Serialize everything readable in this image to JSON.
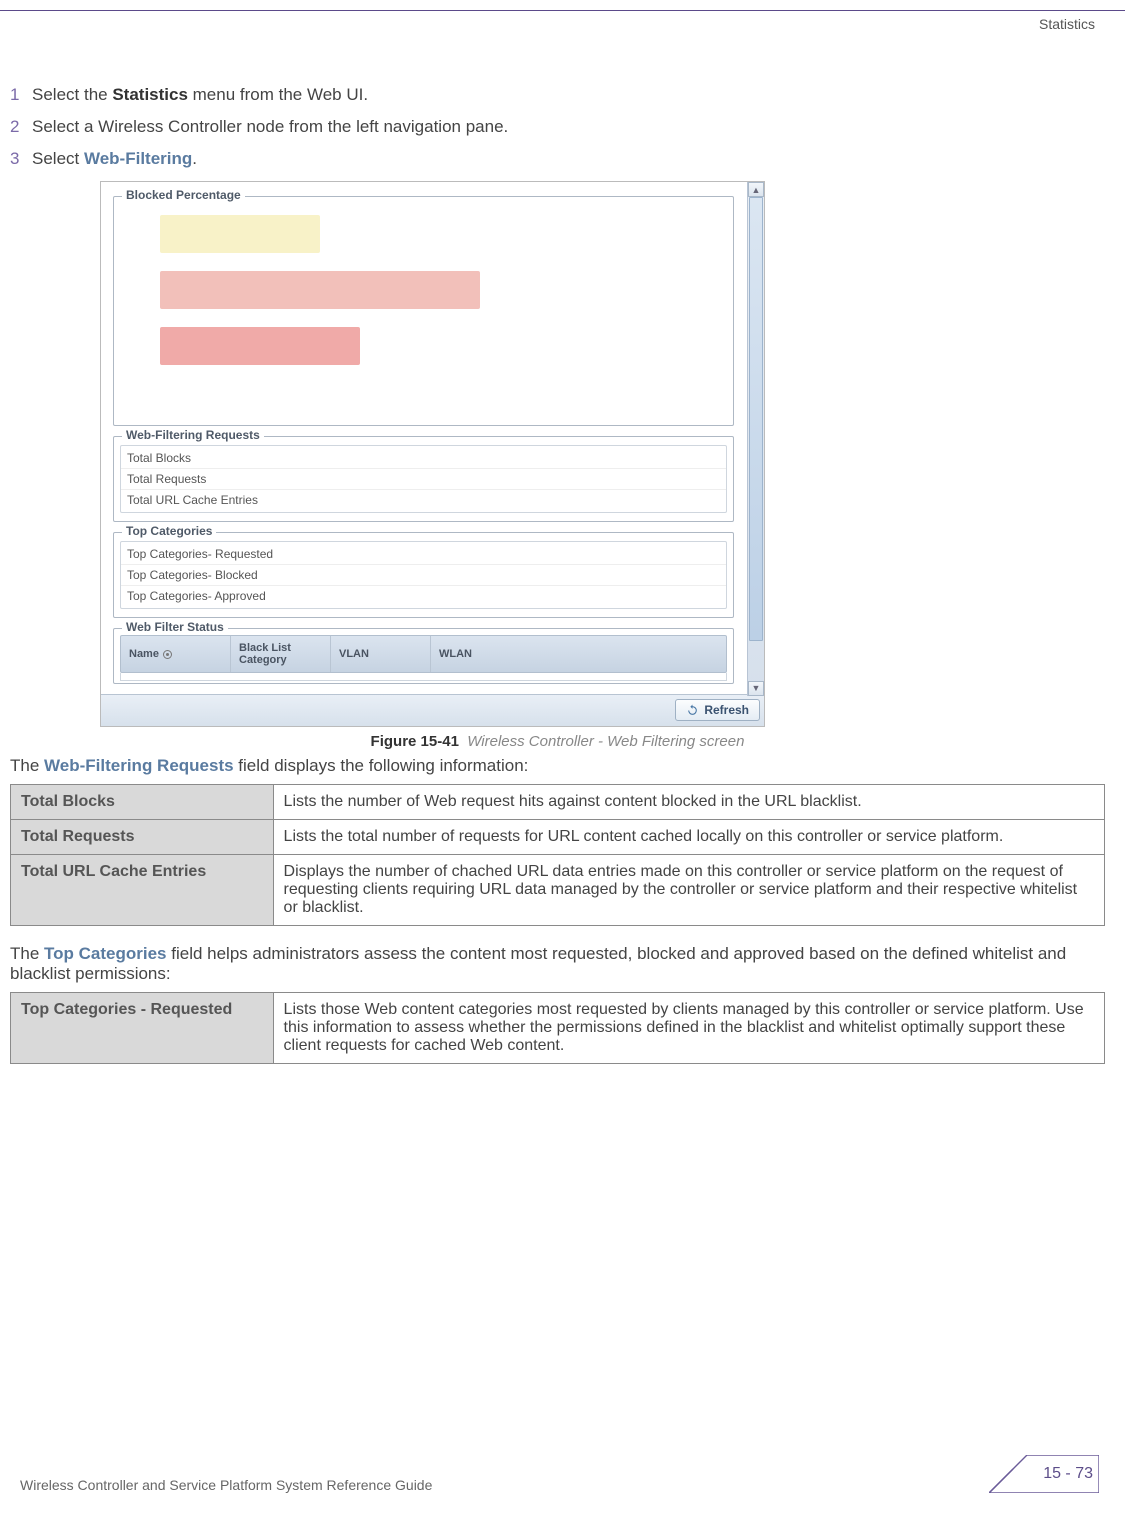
{
  "header": {
    "section": "Statistics"
  },
  "steps": [
    {
      "num": "1",
      "before": "Select the ",
      "bold": "Statistics",
      "after": " menu from the Web UI."
    },
    {
      "num": "2",
      "before": "Select a Wireless Controller node from the left navigation pane.",
      "bold": "",
      "after": ""
    },
    {
      "num": "3",
      "before": "Select ",
      "link": "Web-Filtering",
      "after": "."
    }
  ],
  "screenshot": {
    "blockedPercentage": {
      "legend": "Blocked Percentage"
    },
    "webFilteringRequests": {
      "legend": "Web-Filtering Requests",
      "rows": [
        "Total Blocks",
        "Total Requests",
        "Total URL Cache Entries"
      ]
    },
    "topCategories": {
      "legend": "Top Categories",
      "rows": [
        "Top Categories- Requested",
        "Top Categories- Blocked",
        "Top Categories- Approved"
      ]
    },
    "webFilterStatus": {
      "legend": "Web Filter Status",
      "cols": [
        "Name",
        "Black List Category",
        "VLAN",
        "WLAN"
      ]
    },
    "refresh": "Refresh"
  },
  "figureCaption": {
    "label": "Figure 15-41",
    "desc": "Wireless Controller - Web Filtering screen"
  },
  "intro1": {
    "pre": "The ",
    "link": "Web-Filtering Requests",
    "post": " field displays the following information:"
  },
  "table1": [
    {
      "name": "Total Blocks",
      "desc": "Lists the number of Web request hits against content blocked in the URL blacklist."
    },
    {
      "name": "Total Requests",
      "desc": "Lists the total number of requests for URL content cached locally on this controller or service platform."
    },
    {
      "name": "Total URL Cache Entries",
      "desc": "Displays the number of chached URL data entries made on this controller or service platform on the request of requesting clients requiring URL data managed by the controller or service platform and their respective whitelist or blacklist."
    }
  ],
  "intro2": {
    "pre": "The ",
    "link": "Top Categories",
    "post": " field helps administrators assess the content most requested, blocked and approved based on the defined whitelist and blacklist permissions:"
  },
  "table2": [
    {
      "name": "Top Categories - Requested",
      "desc": "Lists those Web content categories most requested by clients managed by this controller or service platform. Use this information to assess whether the permissions defined in the blacklist and whitelist optimally support these client requests for cached Web content."
    }
  ],
  "footer": {
    "title": "Wireless Controller and Service Platform System Reference Guide",
    "page": "15 - 73"
  }
}
